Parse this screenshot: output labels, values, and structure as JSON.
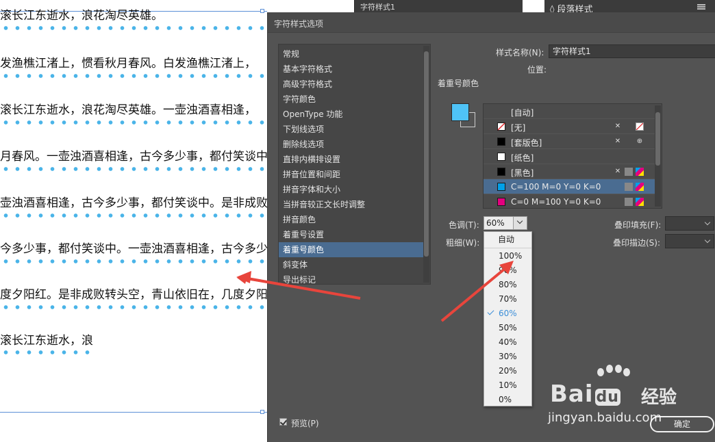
{
  "document": {
    "lines": [
      "滚长江东逝水，浪花淘尽英雄。",
      "发渔樵江渚上，惯看秋月春风。白发渔樵江渚上，",
      "滚长江东逝水，浪花淘尽英雄。一壶浊酒喜相逢，",
      "月春风。一壶浊酒喜相逢，古今多少事，都付笑谈中",
      "壶浊酒喜相逢，古今多少事，都付笑谈中。是非成败转",
      "今多少事，都付笑谈中。一壶浊酒喜相逢，古今多少",
      "度夕阳红。是非成败转头空，青山依旧在，几度夕阳",
      "滚长江东逝水，浪"
    ],
    "emphasis_mark_color": "#4ab4e8"
  },
  "top_panels": {
    "left_tab": "字符样式1",
    "right_tab": "◊ 段落样式"
  },
  "dialog": {
    "title": "字符样式选项",
    "categories": [
      "常规",
      "基本字符格式",
      "高级字符格式",
      "字符颜色",
      "OpenType 功能",
      "下划线选项",
      "删除线选项",
      "直排内横排设置",
      "拼音位置和间距",
      "拼音字体和大小",
      "当拼音较正文长时调整",
      "拼音颜色",
      "着重号设置",
      "着重号颜色",
      "斜变体",
      "导出标记"
    ],
    "selected_category": "着重号颜色",
    "style_name_label": "样式名称(N):",
    "style_name_value": "字符样式1",
    "position_label": "位置:",
    "section_title": "着重号颜色",
    "swatches": [
      {
        "name": "[自动]",
        "color": ""
      },
      {
        "name": "[无]",
        "color": "none"
      },
      {
        "name": "[套版色]",
        "color": "#000000"
      },
      {
        "name": "[纸色]",
        "color": "#ffffff"
      },
      {
        "name": "[黑色]",
        "color": "#000000"
      },
      {
        "name": "C=100 M=0 Y=0 K=0",
        "color": "#00a0e9"
      },
      {
        "name": "C=0 M=100 Y=0 K=0",
        "color": "#e4007f"
      }
    ],
    "selected_swatch": "C=100 M=0 Y=0 K=0",
    "tint_label": "色调(T):",
    "tint_value": "60%",
    "weight_label": "粗细(W):",
    "overprint_fill_label": "叠印填充(F):",
    "overprint_stroke_label": "叠印描边(S):",
    "tint_options": [
      "自动",
      "100%",
      "90%",
      "80%",
      "70%",
      "60%",
      "50%",
      "40%",
      "30%",
      "20%",
      "10%",
      "0%"
    ],
    "tint_selected": "60%",
    "preview_label": "预览(P)",
    "preview_checked": true,
    "ok_label": "确定"
  },
  "watermark": {
    "brand": "Bai",
    "brand_suffix": "du",
    "cn": "经验",
    "url": "jingyan.baidu.com"
  },
  "colors": {
    "dialog_bg": "#535353",
    "selection": "#4a6c91",
    "swatch_cyan": "#4fc3f7",
    "arrow": "#e8453c"
  }
}
